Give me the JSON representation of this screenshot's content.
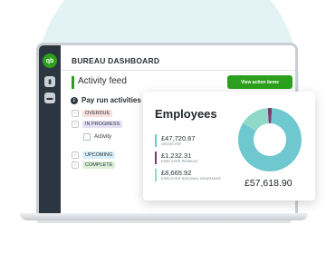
{
  "app": {
    "logo_text": "qb",
    "dashboard_title": "BUREAU DASHBOARD"
  },
  "sidebar": {
    "items": [
      {
        "name": "chart-icon",
        "glyph": "▮"
      },
      {
        "name": "briefcase-icon",
        "glyph": "▬"
      }
    ]
  },
  "activity_feed": {
    "title": "Activity feed",
    "action_button": "View action items"
  },
  "pay_run": {
    "title": "Pay run activities",
    "rows": [
      {
        "status": "OVERDUE"
      },
      {
        "status": "IN PROGRESS"
      },
      {
        "activity": "Activity"
      },
      {
        "status": "UPCOMING"
      },
      {
        "status": "COMPLETE"
      }
    ]
  },
  "employees_card": {
    "title": "Employees",
    "metrics": [
      {
        "value": "£47,720.67",
        "label": "GROSS PAY",
        "color": "#6fc8cf"
      },
      {
        "value": "£1,232.31",
        "label": "EMPLOYER PENSION",
        "color": "#7a3b6c"
      },
      {
        "value": "£8,665.92",
        "label": "EMPLOYER NATIONAL INSURANCE",
        "color": "#8fd9c8"
      }
    ],
    "total": "£57,618.90"
  },
  "chart_data": {
    "type": "pie",
    "donut": true,
    "categories": [
      "Gross pay",
      "Employer pension",
      "Employer national insurance"
    ],
    "values": [
      47720.67,
      1232.31,
      8665.92
    ],
    "colors": [
      "#6fc8cf",
      "#7a3b6c",
      "#8fd9c8"
    ]
  }
}
